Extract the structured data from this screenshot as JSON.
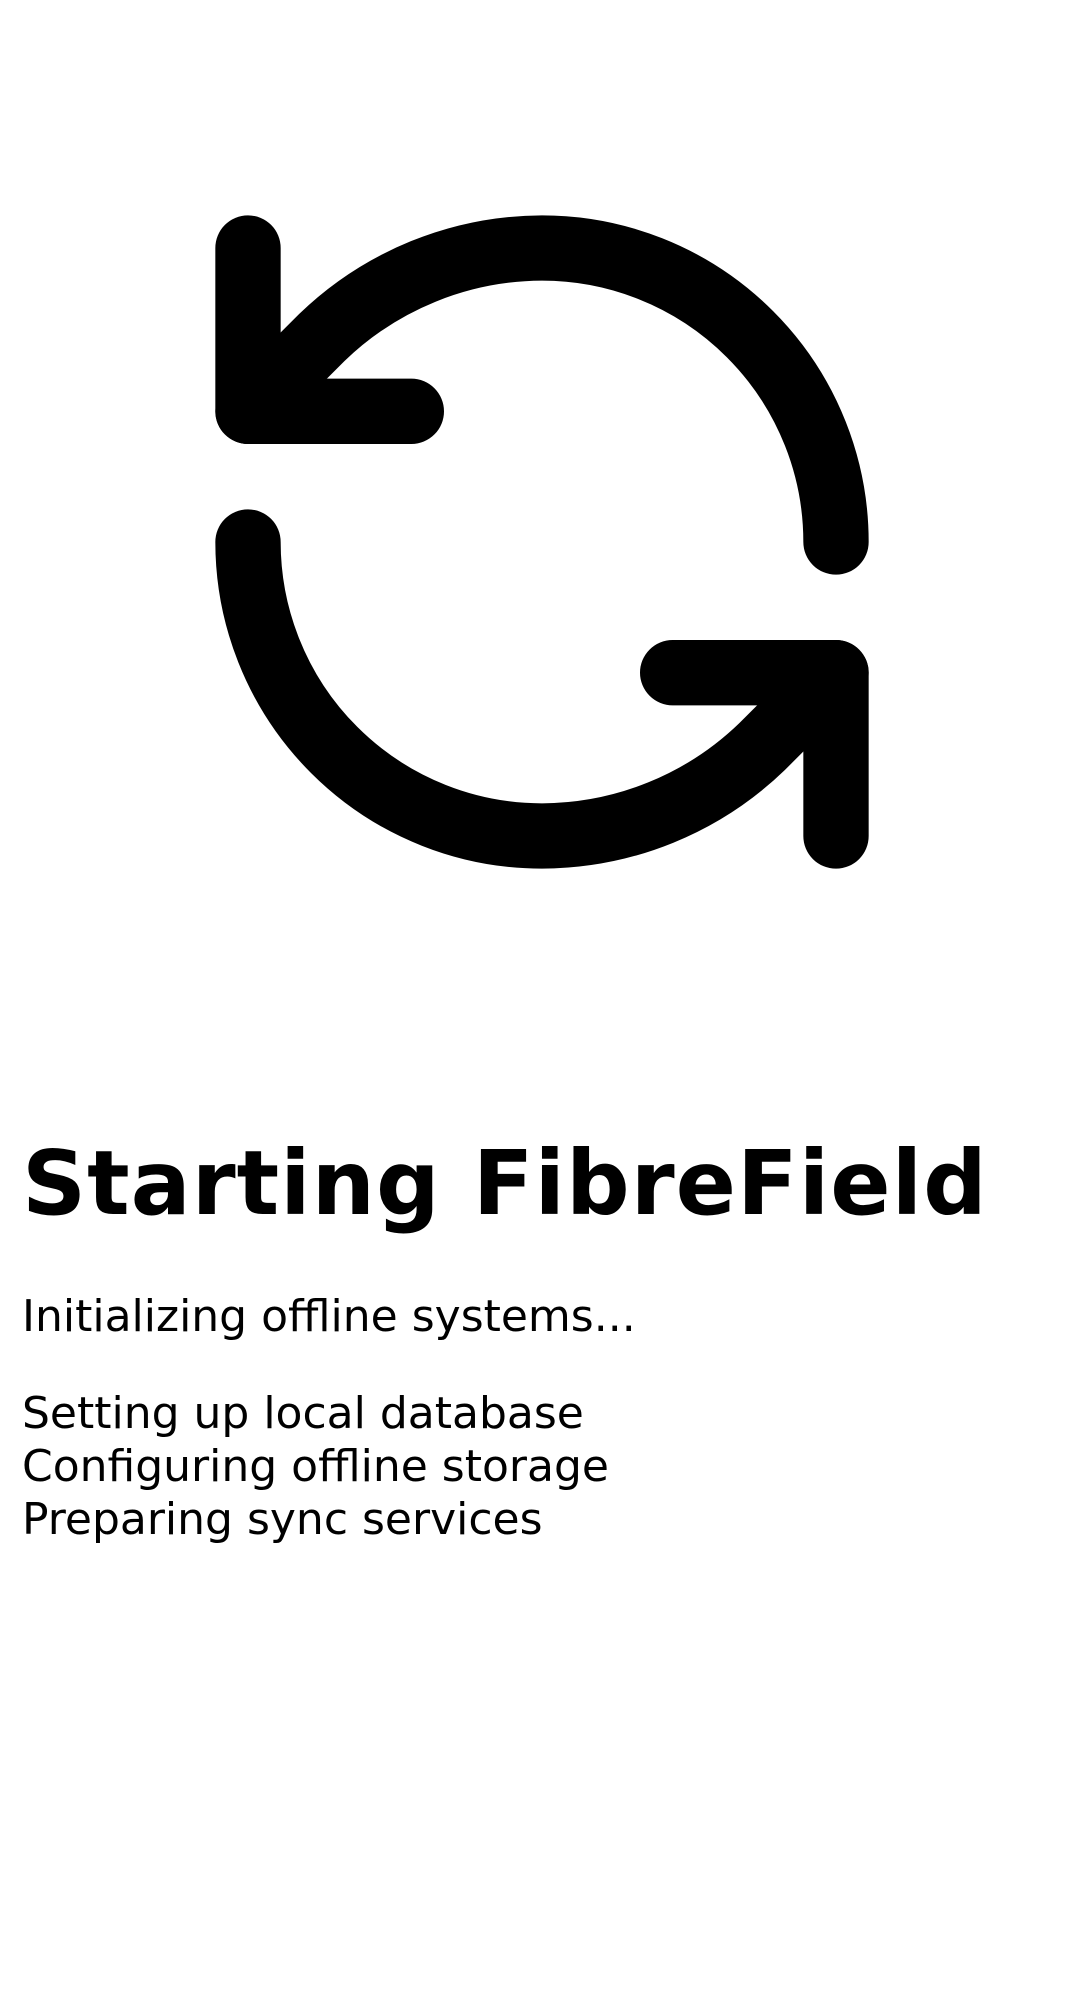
{
  "app": {
    "icon": "refresh-sync-icon",
    "title": "Starting FibreField",
    "status": "Initializing offline systems...",
    "steps": [
      {
        "label": "Setting up local database"
      },
      {
        "label": "Configuring offline storage"
      },
      {
        "label": "Preparing sync services"
      }
    ]
  },
  "colors": {
    "background": "#ffffff",
    "foreground": "#000000"
  }
}
